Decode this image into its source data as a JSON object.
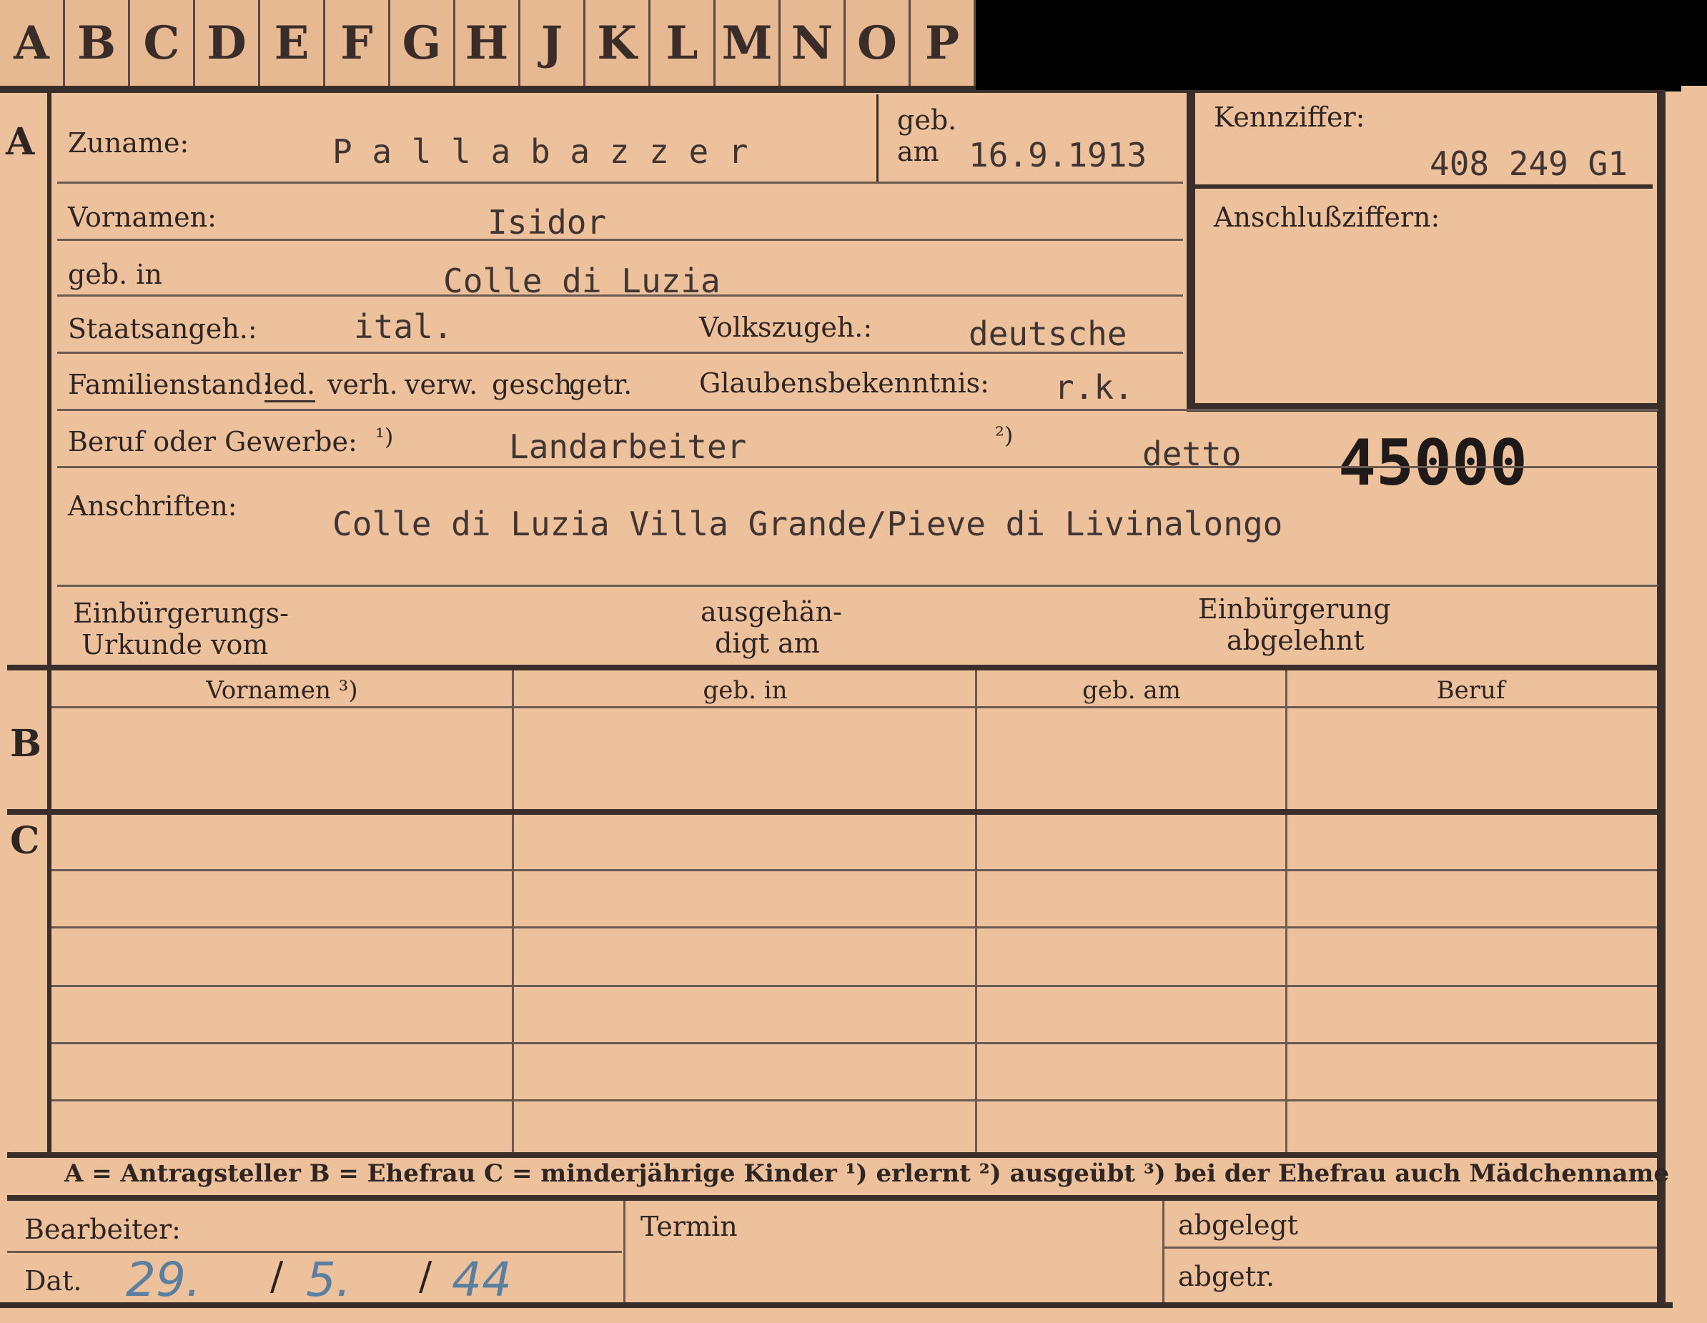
{
  "tabs": [
    "A",
    "B",
    "C",
    "D",
    "E",
    "F",
    "G",
    "H",
    "J",
    "K",
    "L",
    "M",
    "N",
    "O",
    "P"
  ],
  "section_a": {
    "marker": "A",
    "zuname_label": "Zuname:",
    "zuname_value": "P a l l a b a z z e r",
    "geb_label": "geb.",
    "am_label": "am",
    "geb_am_value": "16.9.1913",
    "kennziffer_label": "Kennziffer:",
    "kennziffer_value": "408 249 G1",
    "anschluss_label": "Anschlußziffern:",
    "vornamen_label": "Vornamen:",
    "vornamen_value": "Isidor",
    "geb_in_label": "geb. in",
    "geb_in_value": "Colle di Luzia",
    "staatsangeh_label": "Staatsangeh.:",
    "staatsangeh_value": "ital.",
    "volkszugeh_label": "Volkszugeh.:",
    "volkszugeh_value": "deutsche",
    "familienstand_label": "Familienstand:",
    "familienstand_options": [
      "led.",
      "verh.",
      "verw.",
      "gesch.",
      "getr."
    ],
    "glaubens_label": "Glaubensbekenntnis:",
    "glaubens_value": "r.k.",
    "beruf_label": "Beruf oder Gewerbe:",
    "note1": "¹)",
    "beruf_value": "Landarbeiter",
    "note2": "²)",
    "beruf2_value": "detto",
    "stamp_number": "45000",
    "anschriften_label": "Anschriften:",
    "anschriften_value": "Colle di Luzia Villa Grande/Pieve di Livinalongo",
    "einb_urkunde_label_1": "Einbürgerungs-",
    "einb_urkunde_label_2": "Urkunde vom",
    "ausgeh_label_1": "ausgehän-",
    "ausgeh_label_2": "digt am",
    "einb_abgelehnt_label_1": "Einbürgerung",
    "einb_abgelehnt_label_2": "abgelehnt"
  },
  "section_b": {
    "marker": "B",
    "columns": [
      "Vornamen ³)",
      "geb. in",
      "geb. am",
      "Beruf"
    ]
  },
  "section_c": {
    "marker": "C"
  },
  "legend": "A = Antragsteller   B = Ehefrau   C = minderjährige Kinder   ¹) erlernt   ²) ausgeübt   ³) bei der Ehefrau auch Mädchenname",
  "footer": {
    "bearbeiter_label": "Bearbeiter:",
    "dat_label": "Dat.",
    "date_day": "29.",
    "date_month": "5.",
    "date_year": "44",
    "termin_label": "Termin",
    "abgelegt_label": "abgelegt",
    "abgetr_label": "abgetr."
  }
}
